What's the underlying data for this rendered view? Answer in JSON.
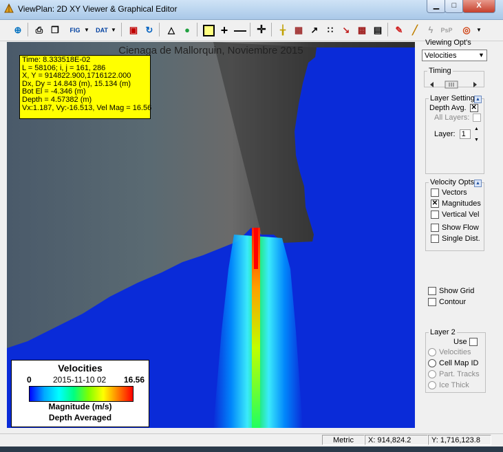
{
  "window": {
    "title": "ViewPlan: 2D XY Viewer & Graphical Editor",
    "close_label": "X"
  },
  "toolbar": {
    "icons": [
      "center-icon",
      "print-icon",
      "copy-icon",
      "fig-export-icon",
      "dat-export-icon",
      "save-icon",
      "refresh-icon",
      "ruler-icon",
      "globe-icon",
      "box-icon",
      "crosshair-icon",
      "line-icon",
      "pan-icon",
      "highlight-icon",
      "grid-icon",
      "graph-icon",
      "dots-icon",
      "chart-icon",
      "profile-icon",
      "camera-icon",
      "pencil-icon",
      "brush-icon",
      "lightning-icon",
      "pp-icon",
      "target-icon"
    ],
    "fig_label": "FIG",
    "dat_label": "DAT",
    "pp_label": "PsP"
  },
  "map": {
    "title": "Cienaga de Mallorquin, Noviembre 2015"
  },
  "info": {
    "time": "Time: 8.333518E-02",
    "cell": "L = 58106;  i, j = 161, 286",
    "xy": "X, Y = 914822.900,1716122.000",
    "dxdy": "Dx, Dy = 14.843 (m), 15.134 (m)",
    "botel": "Bot El = -4.346 (m)",
    "depth": "Depth = 4.57382 (m)",
    "vel": "Vx:1.187, Vy:-16.513, Vel Mag = 16.56"
  },
  "legend": {
    "title": "Velocities",
    "min": "0",
    "date": "2015-11-10 02",
    "max": "16.56",
    "unit": "Magnitude  (m/s)",
    "sub": "Depth Averaged"
  },
  "side": {
    "viewing_label": "Viewing Opt's",
    "viewing_value": "Velocities",
    "timing_label": "Timing",
    "layer_settings": {
      "title": "Layer Settings",
      "depth_avg": "Depth Avg.",
      "all_layers": "All Layers:",
      "layer_label": "Layer:",
      "layer_value": "1"
    },
    "velocity_opts": {
      "title": "Velocity Opts",
      "items": [
        {
          "label": "Vectors",
          "checked": false
        },
        {
          "label": "Magnitudes",
          "checked": true
        },
        {
          "label": "Vertical Vel",
          "checked": false
        },
        {
          "label": "Show Flow",
          "checked": false
        },
        {
          "label": "Single Dist.",
          "checked": false
        }
      ]
    },
    "show_grid": "Show Grid",
    "contour": "Contour",
    "layer2": {
      "title": "Layer 2",
      "use": "Use",
      "options": [
        "Velocities",
        "Cell Map ID",
        "Part. Tracks",
        "Ice Thick"
      ]
    }
  },
  "status": {
    "units": "Metric",
    "x": "X: 914,824.2",
    "y": "Y: 1,716,123.8"
  },
  "colors": {
    "water": "#0a2bd8",
    "info_bg": "#ffff00",
    "land": "#3c3c3c"
  }
}
